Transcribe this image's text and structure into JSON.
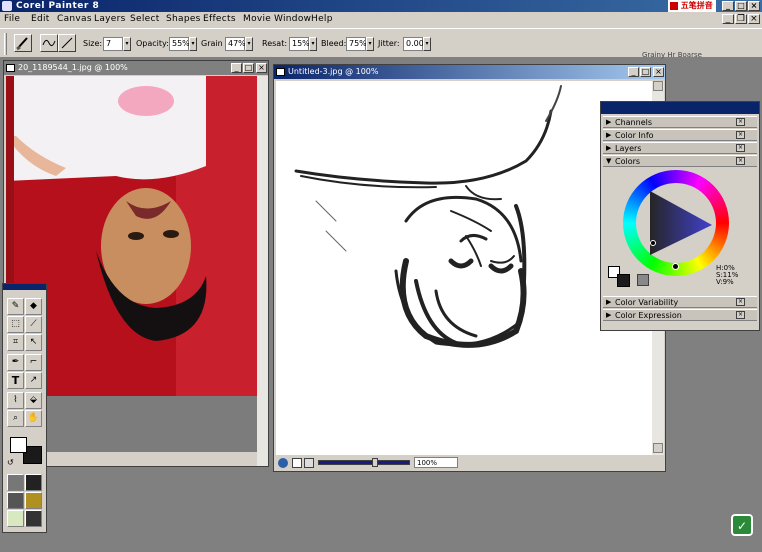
{
  "app": {
    "title": "Corel Painter 8",
    "ime_label": "五笔拼音"
  },
  "menu": [
    "File",
    "Edit",
    "Canvas",
    "Layers",
    "Select",
    "Shapes",
    "Effects",
    "Movie",
    "Window",
    "Help"
  ],
  "properties": {
    "size_label": "Size:",
    "size_value": "7",
    "opacity_label": "Opacity:",
    "opacity_value": "55%",
    "grain_label": "Grain",
    "grain_value": "47%",
    "resat_label": "Resat:",
    "resat_value": "15%",
    "bleed_label": "Bleed:",
    "bleed_value": "75%",
    "jitter_label": "Jitter:",
    "jitter_value": "0.00",
    "brush_variant_hint": "Grainy Hr Boarse"
  },
  "photo_window": {
    "title": "20_1189544_1.jpg @ 100%"
  },
  "canvas_window": {
    "title": "Untitled-3.jpg @ 100%",
    "zoom": "100%"
  },
  "colors_panel": {
    "sections_top": [
      "Channels",
      "Color Info",
      "Layers",
      "Colors"
    ],
    "sections_bottom": [
      "Color Variability",
      "Color Expression"
    ],
    "hsv": {
      "h": "H:0%",
      "s": "S:11%",
      "v": "V:9%"
    }
  }
}
